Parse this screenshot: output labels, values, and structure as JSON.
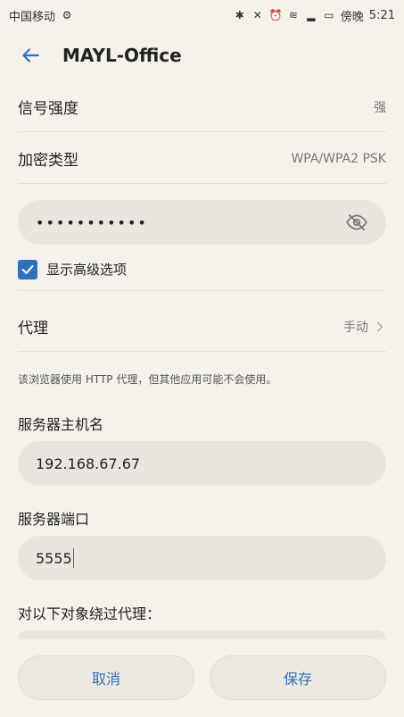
{
  "statusbar": {
    "carrier": "中国移动",
    "carrier_icon": "gear-icon",
    "time": "5:21",
    "right_text": "傍晚"
  },
  "appbar": {
    "title": "MAYL-Office"
  },
  "rows": {
    "signal_label": "信号强度",
    "signal_value": "强",
    "encryption_label": "加密类型",
    "encryption_value": "WPA/WPA2 PSK",
    "proxy_label": "代理",
    "proxy_value": "手动"
  },
  "password": {
    "value": "•••••••••••"
  },
  "advanced": {
    "label": "显示高级选项",
    "checked": true
  },
  "note": "该浏览器使用 HTTP 代理，但其他应用可能不会使用。",
  "server": {
    "host_label": "服务器主机名",
    "host_value": "192.168.67.67",
    "port_label": "服务器端口",
    "port_value": "5555",
    "bypass_label": "对以下对象绕过代理："
  },
  "buttons": {
    "cancel": "取消",
    "save": "保存"
  },
  "colors": {
    "accent": "#2f6fbd",
    "background": "#f5f2ec",
    "field": "#e9e5df"
  }
}
